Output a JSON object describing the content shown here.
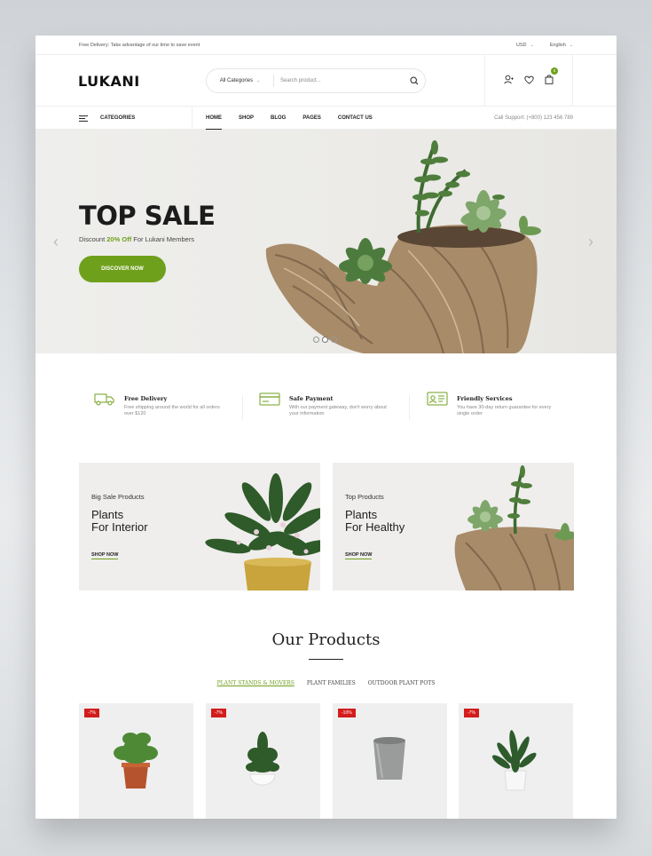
{
  "topbar": {
    "promo": "Free Delivery: Take advantage of our time to save event",
    "currency": "USD",
    "language": "English"
  },
  "header": {
    "logo": "LUKANI",
    "search_category": "All Categories",
    "search_placeholder": "Search product...",
    "cart_count": "0"
  },
  "nav": {
    "categories_label": "CATEGORIES",
    "links": [
      "HOME",
      "SHOP",
      "BLOG",
      "PAGES",
      "CONTACT US"
    ],
    "active": "HOME",
    "support": "Call Support: (+800) 123 456 789"
  },
  "hero": {
    "title": "TOP SALE",
    "subtitle_prefix": "Discount ",
    "subtitle_highlight": "20% Off",
    "subtitle_suffix": " For Lukani Members",
    "button": "DISCOVER NOW",
    "slide_count": 3,
    "active_slide": 2
  },
  "features": [
    {
      "title": "Free Delivery",
      "desc": "Free shipping around the world for all orders over $120",
      "icon": "truck-icon"
    },
    {
      "title": "Safe Payment",
      "desc": "With our payment gateway, don't worry about your information",
      "icon": "credit-card-icon"
    },
    {
      "title": "Friendly Services",
      "desc": "You have 30-day return guarantee for every single order",
      "icon": "id-card-icon"
    }
  ],
  "banners": [
    {
      "kicker": "Big Sale Products",
      "line1": "Plants",
      "line2": "For Interior",
      "link": "SHOP NOW"
    },
    {
      "kicker": "Top Products",
      "line1": "Plants",
      "line2": "For Healthy",
      "link": "SHOP NOW"
    }
  ],
  "products": {
    "heading": "Our Products",
    "tabs": [
      "PLANT STANDS & MOVERS",
      "PLANT FAMILIES",
      "OUTDOOR PLANT POTS"
    ],
    "active_tab": "PLANT STANDS & MOVERS",
    "cards": [
      {
        "badge": "-7%"
      },
      {
        "badge": "-7%"
      },
      {
        "badge": "-10%"
      },
      {
        "badge": "-7%"
      }
    ]
  },
  "colors": {
    "accent": "#6fa01c",
    "sale": "#d31c1c"
  }
}
